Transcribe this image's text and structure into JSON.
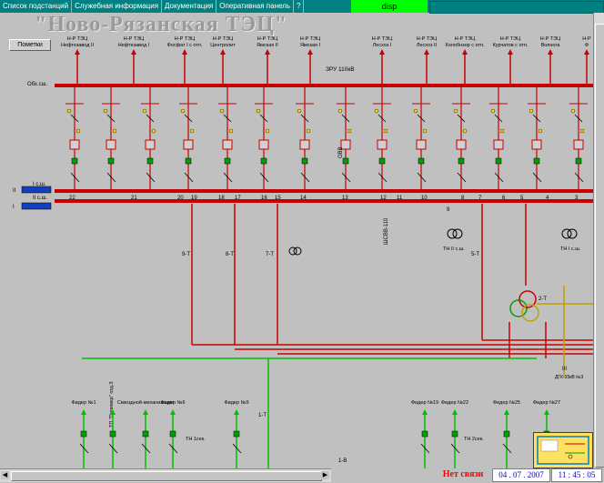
{
  "menu": {
    "items": [
      "Список подстанций",
      "Служебная информация",
      "Документация",
      "Оперативная панель",
      "?"
    ],
    "disp": "disp"
  },
  "title": "\"Ново-Рязанская ТЭЦ\"",
  "notes_button": "Пометки",
  "bus": {
    "upper_label": "Обх.сш.",
    "zru_label": "ЗРУ 110кВ",
    "section1": "I с.ш.",
    "section2": "II с.ш.",
    "left_marks": [
      "II",
      "I"
    ],
    "cell_numbers": [
      "22",
      "21",
      "20",
      "19",
      "18",
      "17",
      "16",
      "15",
      "14",
      "13",
      "12",
      "11",
      "10",
      "8",
      "7",
      "6",
      "5",
      "4",
      "3"
    ],
    "ovv": "ОВВ",
    "shsv": "ШСВВ-110",
    "num9": "9"
  },
  "feeders_top": [
    {
      "l1": "Н-Р ТЭЦ",
      "l2": "Нефтезавод II"
    },
    {
      "l1": "Н-Р ТЭЦ",
      "l2": "Нефтезавод I"
    },
    {
      "l1": "Н-Р ТЭЦ",
      "l2": "Фосфат I с отп."
    },
    {
      "l1": "Н-Р ТЭЦ",
      "l2": "Центролит"
    },
    {
      "l1": "Н-Р ТЭЦ",
      "l2": "Ямская II"
    },
    {
      "l1": "Н-Р ТЭЦ",
      "l2": "Ямская I"
    },
    {
      "l1": "Н-Р ТЭЦ",
      "l2": "Лесхоз I"
    },
    {
      "l1": "Н-Р ТЭЦ",
      "l2": "Лесхоз II"
    },
    {
      "l1": "Н-Р ТЭЦ",
      "l2": "Колобнзор с отп."
    },
    {
      "l1": "Н-Р ТЭЦ",
      "l2": "Курчатов с отп."
    },
    {
      "l1": "Н-Р ТЭЦ",
      "l2": "Волнога"
    },
    {
      "l1": "Н-Р",
      "l2": "Ф"
    }
  ],
  "transformers": {
    "t9": "9-Т",
    "t8": "8-Т",
    "t7": "7-Т",
    "t5": "5-Т",
    "t2": "2-Т",
    "t1": "1-Т",
    "tn2": "ТН II с.ш.",
    "tn1": "ТН I с.ш.",
    "tn1sek": "ТН 1сек.",
    "tn2sek": "ТН 2сек.",
    "iii": "III",
    "dgr": "ДГК-35кВ №3",
    "ib": "1-В"
  },
  "feeders_bottom": [
    {
      "label": "Фидер №1"
    },
    {
      "label": "ТП \"Полимер\" отд.3"
    },
    {
      "label": "Сквоздной-механизации"
    },
    {
      "label": "Фидер №6"
    },
    {
      "label": "Фидер №9"
    },
    {
      "label": "Фидер №19"
    },
    {
      "label": "Фидер №22"
    },
    {
      "label": "Фидер №25"
    },
    {
      "label": "Фидер №27"
    }
  ],
  "status": {
    "no_link": "Нет связи",
    "date": "04 . 07 . 2007",
    "time": "11 : 45 : 05"
  },
  "colors": {
    "bus_red": "#c80000",
    "green_line": "#00c000",
    "yellow_line": "#c0a000",
    "background": "#c0c0c0",
    "menu_bg": "#008080",
    "disp_bg": "#00ff00"
  }
}
